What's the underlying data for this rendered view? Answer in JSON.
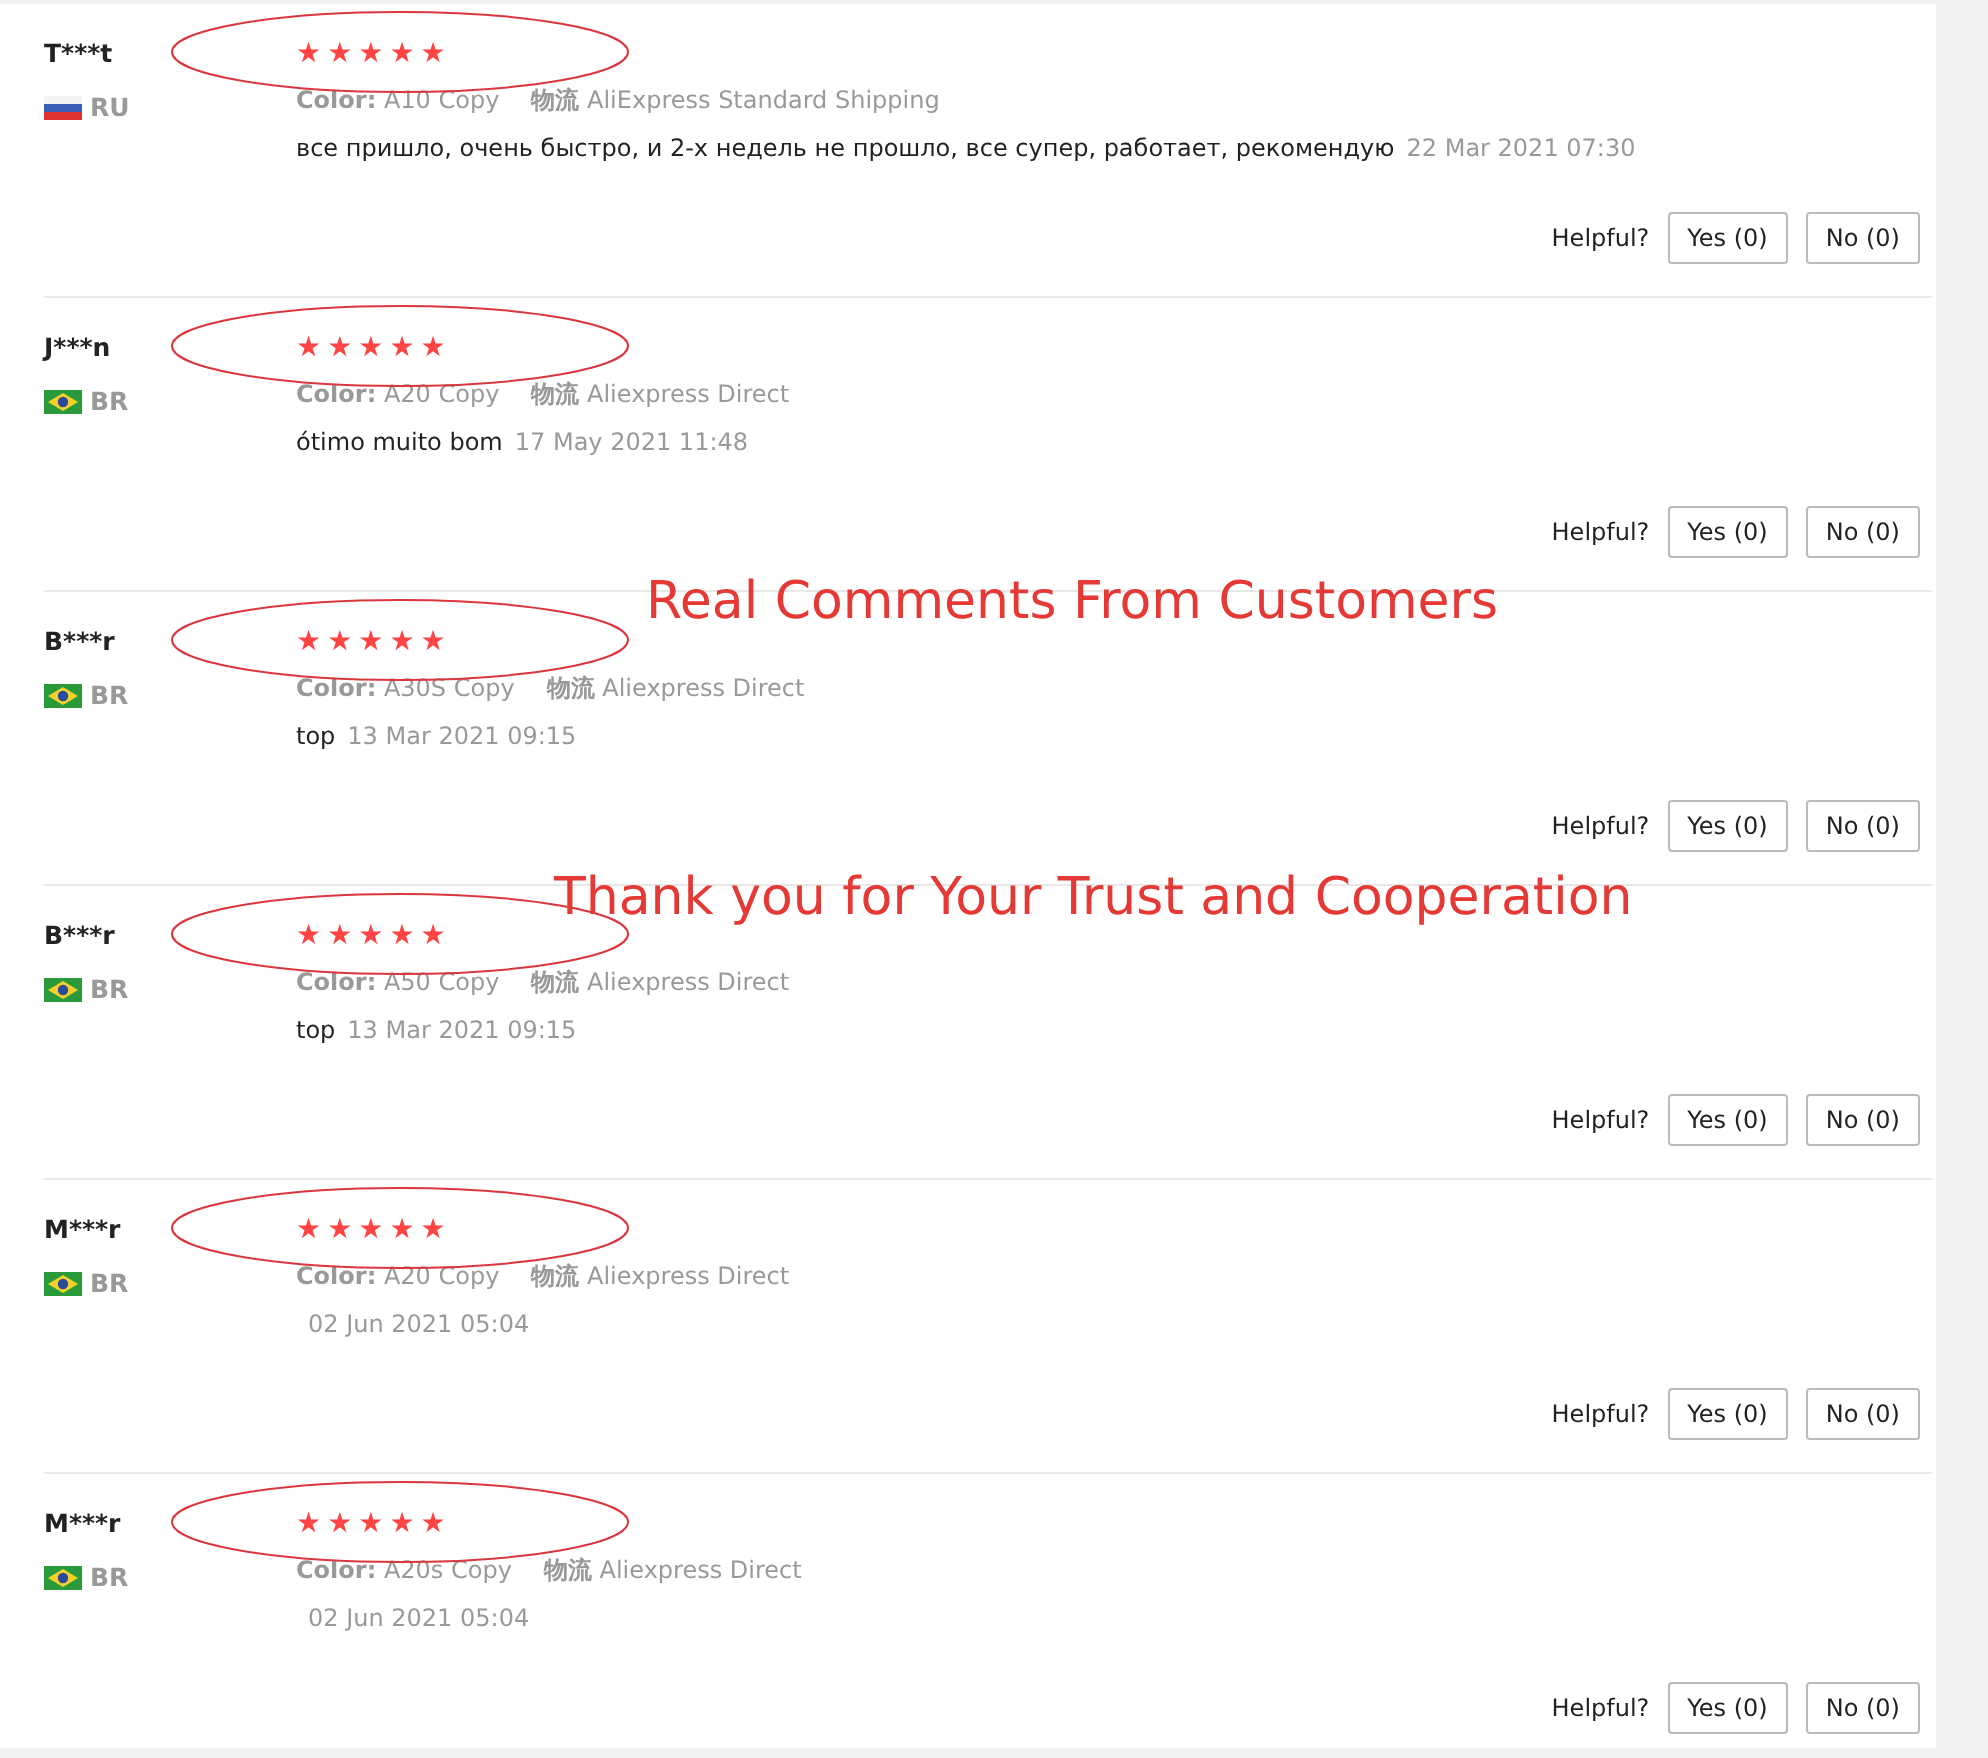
{
  "reviews": [
    {
      "name": "T***t",
      "flag": {
        "kind": "ru"
      },
      "country": "RU",
      "stars": 5,
      "color_label": "Color:",
      "color_value": "A10 Copy",
      "shipping_label": "物流",
      "shipping": "AliExpress Standard Shipping",
      "comment": "все пришло, очень быстро, и 2-х недель не прошло, все супер, работает, рекомендую",
      "date": "22 Mar 2021 07:30",
      "helpful_label": "Helpful?",
      "yes": "Yes (0)",
      "no": "No (0)"
    },
    {
      "name": "J***n",
      "flag": {
        "kind": "br"
      },
      "country": "BR",
      "stars": 5,
      "color_label": "Color:",
      "color_value": "A20 Copy",
      "shipping_label": "物流",
      "shipping": "Aliexpress Direct",
      "comment": "ótimo muito bom",
      "date": "17 May 2021 11:48",
      "helpful_label": "Helpful?",
      "yes": "Yes (0)",
      "no": "No (0)"
    },
    {
      "name": "B***r",
      "flag": {
        "kind": "br"
      },
      "country": "BR",
      "stars": 5,
      "color_label": "Color:",
      "color_value": "A30S Copy",
      "shipping_label": "物流",
      "shipping": "Aliexpress Direct",
      "comment": "top",
      "date": "13 Mar 2021 09:15",
      "helpful_label": "Helpful?",
      "yes": "Yes (0)",
      "no": "No (0)"
    },
    {
      "name": "B***r",
      "flag": {
        "kind": "br"
      },
      "country": "BR",
      "stars": 5,
      "color_label": "Color:",
      "color_value": "A50 Copy",
      "shipping_label": "物流",
      "shipping": "Aliexpress Direct",
      "comment": "top",
      "date": "13 Mar 2021 09:15",
      "helpful_label": "Helpful?",
      "yes": "Yes (0)",
      "no": "No (0)"
    },
    {
      "name": "M***r",
      "flag": {
        "kind": "br"
      },
      "country": "BR",
      "stars": 5,
      "color_label": "Color:",
      "color_value": "A20 Copy",
      "shipping_label": "物流",
      "shipping": "Aliexpress Direct",
      "date": "02 Jun 2021 05:04",
      "helpful_label": "Helpful?",
      "yes": "Yes (0)",
      "no": "No (0)"
    },
    {
      "name": "M***r",
      "flag": {
        "kind": "br"
      },
      "country": "BR",
      "stars": 5,
      "color_label": "Color:",
      "color_value": "A20s Copy",
      "shipping_label": "物流",
      "shipping": "Aliexpress Direct",
      "date": "02 Jun 2021 05:04",
      "helpful_label": "Helpful?",
      "yes": "Yes (0)",
      "no": "No (0)"
    }
  ],
  "captions": [
    "Real Comments From Customers",
    "Thank you for Your Trust and Cooperation"
  ]
}
